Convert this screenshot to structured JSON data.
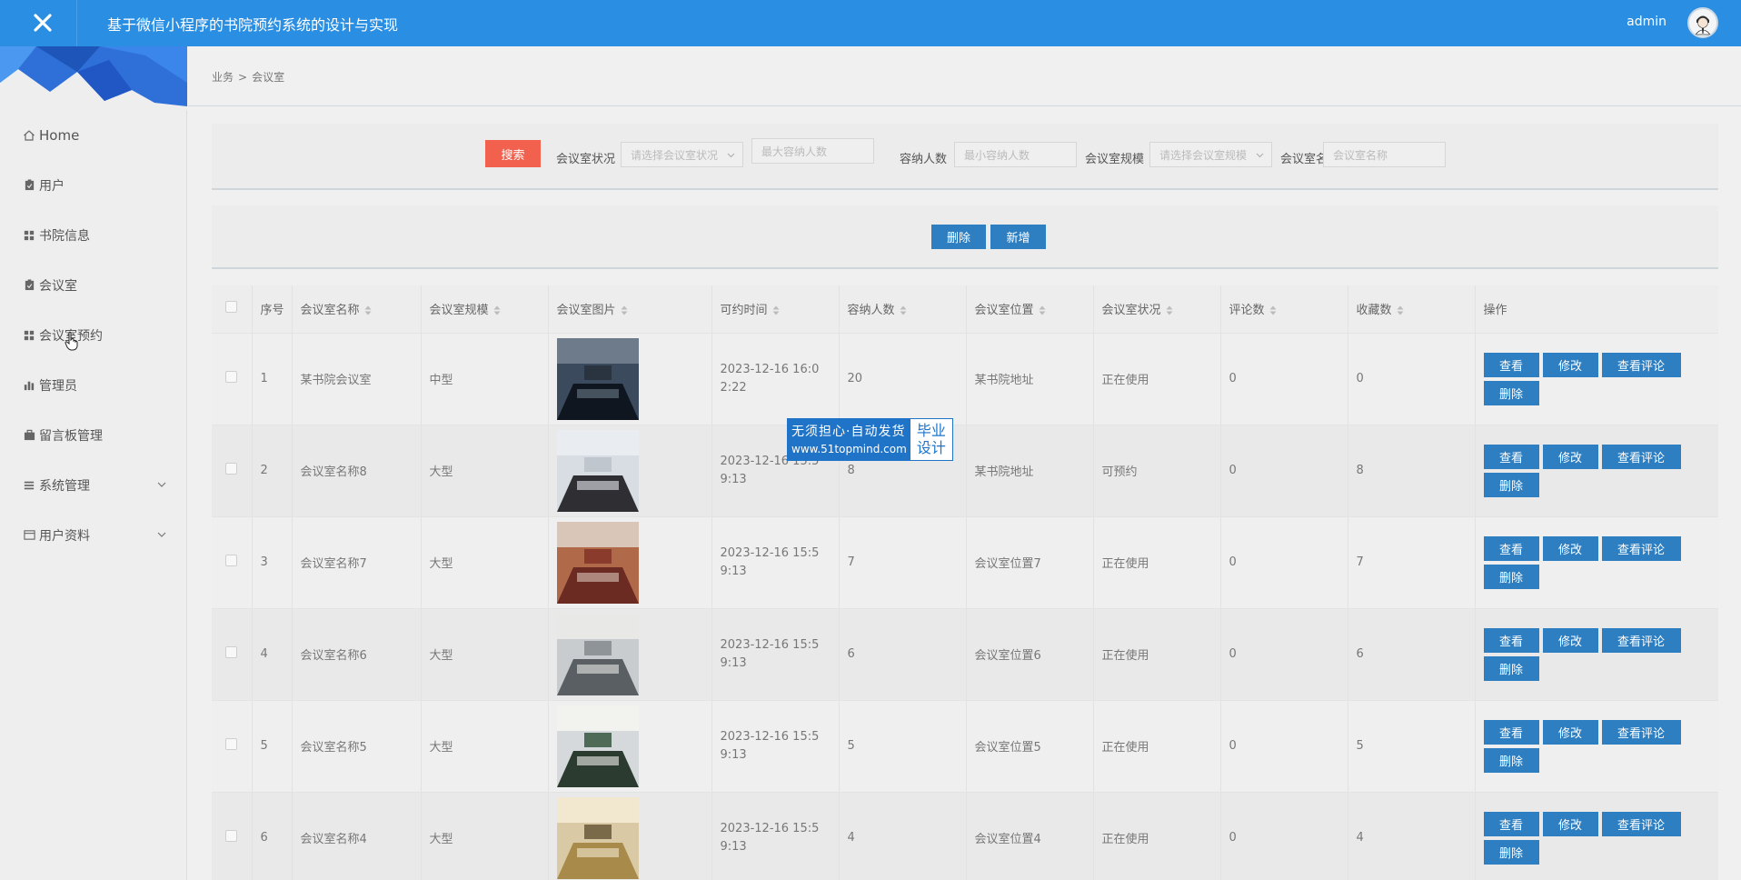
{
  "header": {
    "title": "基于微信小程序的书院预约系统的设计与实现",
    "user": "admin"
  },
  "sidebar": {
    "items": [
      {
        "label": "Home",
        "icon": "home-icon"
      },
      {
        "label": "用户",
        "icon": "clipboard-icon"
      },
      {
        "label": "书院信息",
        "icon": "grid-icon"
      },
      {
        "label": "会议室",
        "icon": "clipboard-icon"
      },
      {
        "label": "会议室预约",
        "icon": "grid-icon"
      },
      {
        "label": "管理员",
        "icon": "bar-chart-icon"
      },
      {
        "label": "留言板管理",
        "icon": "briefcase-icon"
      },
      {
        "label": "系统管理",
        "icon": "list-icon"
      },
      {
        "label": "用户资料",
        "icon": "card-icon"
      }
    ]
  },
  "breadcrumb": {
    "parent": "业务",
    "sep": ">",
    "current": "会议室"
  },
  "search": {
    "button": "搜索",
    "status_label": "会议室状况",
    "status_placeholder": "请选择会议室状况",
    "max_placeholder": "最大容纳人数",
    "capacity_label": "容纳人数",
    "min_placeholder": "最小容纳人数",
    "scale_label": "会议室规模",
    "scale_placeholder": "请选择会议室规模",
    "name_label": "会议室名称",
    "name_placeholder": "会议室名称"
  },
  "actions": {
    "delete": "删除",
    "add": "新增"
  },
  "table": {
    "headers": [
      "序号",
      "会议室名称",
      "会议室规模",
      "会议室图片",
      "可约时间",
      "容纳人数",
      "会议室位置",
      "会议室状况",
      "评论数",
      "收藏数",
      "操作"
    ],
    "ops": {
      "view": "查看",
      "edit": "修改",
      "comments": "查看评论",
      "delete": "删除"
    },
    "rows": [
      {
        "no": "1",
        "name": "某书院会议室",
        "scale": "中型",
        "time": "2023-12-16 16:02:22",
        "capacity": "20",
        "location": "某书院地址",
        "status": "正在使用",
        "comments": "0",
        "favorites": "0"
      },
      {
        "no": "2",
        "name": "会议室名称8",
        "scale": "大型",
        "time": "2023-12-16 15:59:13",
        "capacity": "8",
        "location": "某书院地址",
        "status": "可预约",
        "comments": "0",
        "favorites": "8"
      },
      {
        "no": "3",
        "name": "会议室名称7",
        "scale": "大型",
        "time": "2023-12-16 15:59:13",
        "capacity": "7",
        "location": "会议室位置7",
        "status": "正在使用",
        "comments": "0",
        "favorites": "7"
      },
      {
        "no": "4",
        "name": "会议室名称6",
        "scale": "大型",
        "time": "2023-12-16 15:59:13",
        "capacity": "6",
        "location": "会议室位置6",
        "status": "正在使用",
        "comments": "0",
        "favorites": "6"
      },
      {
        "no": "5",
        "name": "会议室名称5",
        "scale": "大型",
        "time": "2023-12-16 15:59:13",
        "capacity": "5",
        "location": "会议室位置5",
        "status": "正在使用",
        "comments": "0",
        "favorites": "5"
      },
      {
        "no": "6",
        "name": "会议室名称4",
        "scale": "大型",
        "time": "2023-12-16 15:59:13",
        "capacity": "4",
        "location": "会议室位置4",
        "status": "正在使用",
        "comments": "0",
        "favorites": "4"
      }
    ]
  },
  "watermark": {
    "line1": "无须担心·自动发货",
    "line2": "www.51topmind.com",
    "badge1": "毕业",
    "badge2": "设计"
  },
  "colors": {
    "topbar": "#2a8ee3",
    "search_button": "#f1614e",
    "primary_button": "#2d7fc2"
  }
}
